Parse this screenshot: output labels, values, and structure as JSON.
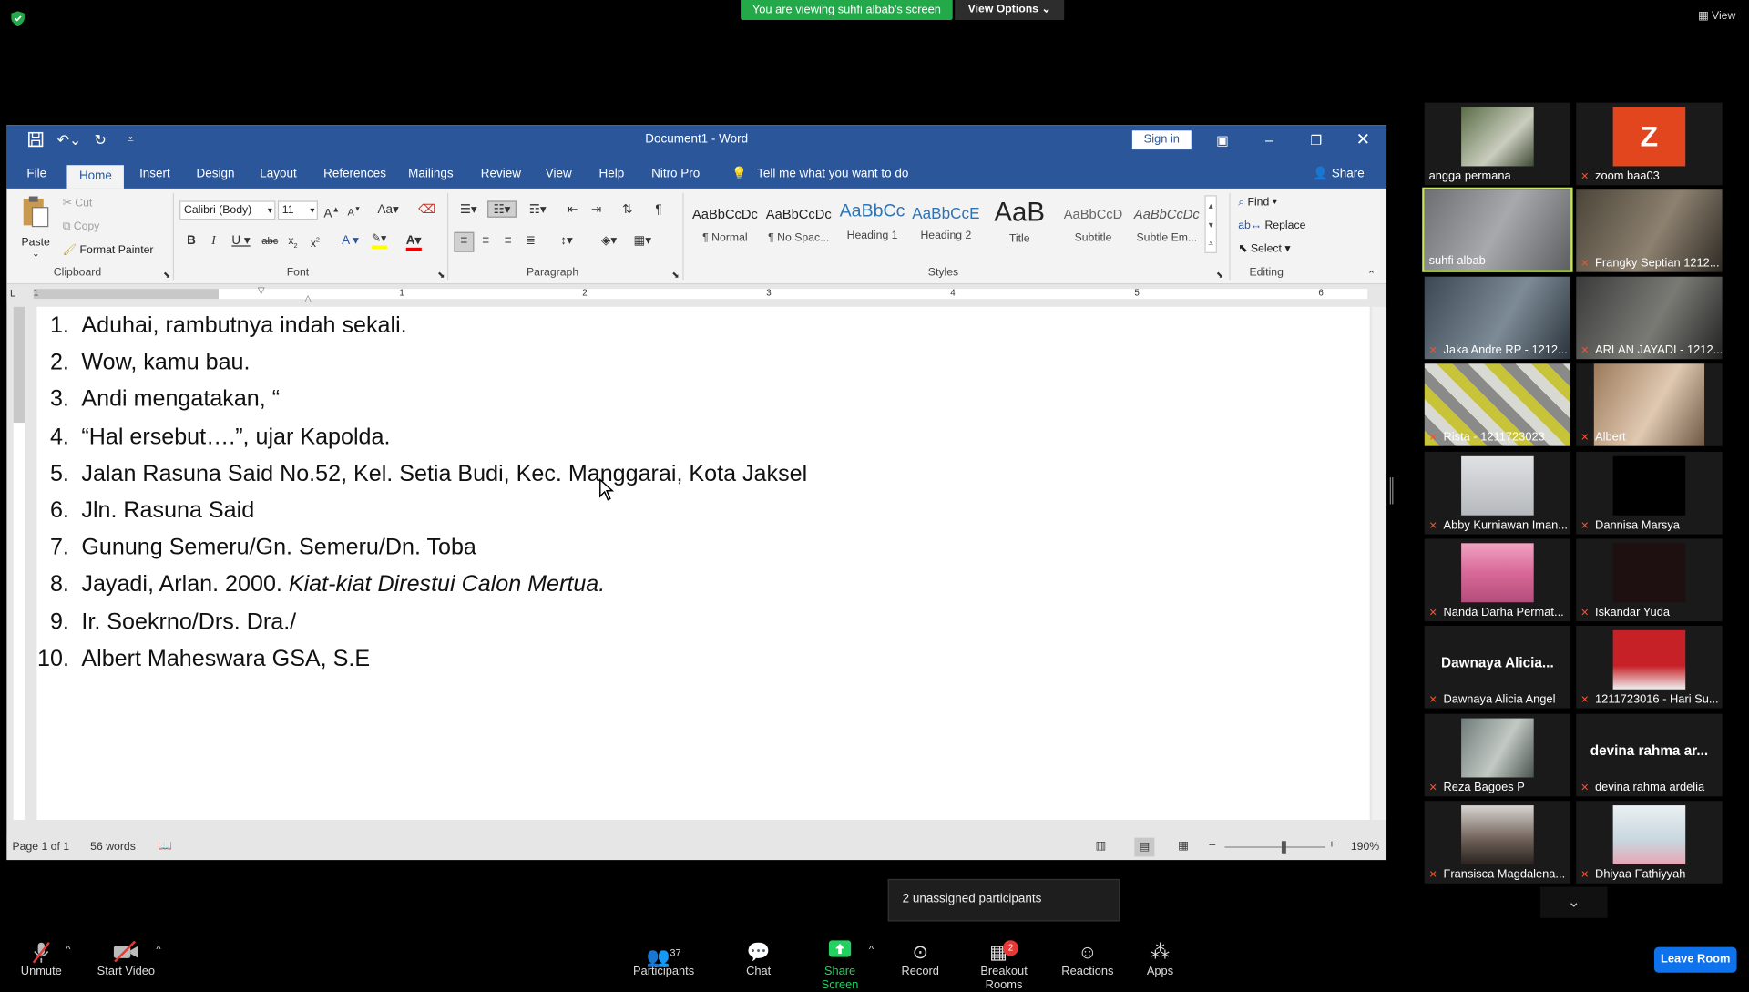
{
  "zoom": {
    "banner": "You are viewing suhfi albab's screen",
    "view_options": "View Options ⌄",
    "view_label": "View",
    "unassigned": "2 unassigned participants",
    "toolbar": {
      "unmute": "Unmute",
      "start_video": "Start Video",
      "participants": "Participants",
      "participants_count": "37",
      "chat": "Chat",
      "share_screen": "Share Screen",
      "record": "Record",
      "breakout_rooms": "Breakout Rooms",
      "breakout_badge": "2",
      "reactions": "Reactions",
      "apps": "Apps",
      "leave": "Leave Room"
    },
    "participants": [
      {
        "name": "angga permana",
        "muted": false,
        "video": true
      },
      {
        "name": "zoom baa03",
        "muted": true,
        "video": false,
        "initial": "Z"
      },
      {
        "name": "suhfi albab",
        "muted": false,
        "video": true,
        "speaking": true
      },
      {
        "name": "Frangky Septian 1212...",
        "muted": true,
        "video": true
      },
      {
        "name": "Jaka Andre RP - 1212...",
        "muted": true,
        "video": true
      },
      {
        "name": "ARLAN JAYADI - 1212...",
        "muted": true,
        "video": true
      },
      {
        "name": "Rista - 1211723023",
        "muted": true,
        "video": true
      },
      {
        "name": "Albert",
        "muted": true,
        "video": true
      },
      {
        "name": "Abby Kurniawan Iman...",
        "muted": true,
        "video": true
      },
      {
        "name": "Dannisa Marsya",
        "muted": true,
        "video": true
      },
      {
        "name": "Nanda Darha Permat...",
        "muted": true,
        "video": true
      },
      {
        "name": "Iskandar Yuda",
        "muted": true,
        "video": true
      },
      {
        "name": "Dawnaya Alicia Angel",
        "muted": true,
        "video": false,
        "big_label": "Dawnaya  Alicia..."
      },
      {
        "name": "1211723016 - Hari Su...",
        "muted": true,
        "video": true
      },
      {
        "name": "Reza Bagoes P",
        "muted": true,
        "video": true
      },
      {
        "name": "devina rahma ardelia",
        "muted": true,
        "video": false,
        "big_label": "devina rahma ar..."
      },
      {
        "name": "Fransisca Magdalena...",
        "muted": true,
        "video": true
      },
      {
        "name": "Dhiyaa Fathiyyah",
        "muted": true,
        "video": true
      }
    ]
  },
  "word": {
    "title": "Document1  -  Word",
    "sign_in": "Sign in",
    "share": "Share",
    "tabs": [
      "File",
      "Home",
      "Insert",
      "Design",
      "Layout",
      "References",
      "Mailings",
      "Review",
      "View",
      "Help",
      "Nitro Pro"
    ],
    "tell_me": "Tell me what you want to do",
    "clipboard": {
      "paste": "Paste",
      "cut": "Cut",
      "copy": "Copy",
      "format_painter": "Format Painter",
      "label": "Clipboard"
    },
    "font": {
      "name": "Calibri (Body)",
      "size": "11",
      "label": "Font"
    },
    "paragraph_label": "Paragraph",
    "styles": {
      "label": "Styles",
      "items": [
        {
          "preview": "AaBbCcDc",
          "name": "¶ Normal"
        },
        {
          "preview": "AaBbCcDc",
          "name": "¶ No Spac..."
        },
        {
          "preview": "AaBbCc",
          "name": "Heading 1"
        },
        {
          "preview": "AaBbCcE",
          "name": "Heading 2"
        },
        {
          "preview": "AaB",
          "name": "Title"
        },
        {
          "preview": "AaBbCcD",
          "name": "Subtitle"
        },
        {
          "preview": "AaBbCcDc",
          "name": "Subtle Em..."
        }
      ]
    },
    "editing": {
      "find": "Find",
      "replace": "Replace",
      "select": "Select",
      "label": "Editing"
    },
    "ruler_numbers": [
      "1",
      "1",
      "2",
      "3",
      "4",
      "5",
      "6"
    ],
    "document_lines": [
      {
        "n": "1.",
        "text": "Aduhai, rambutnya indah sekali."
      },
      {
        "n": "2.",
        "text": "Wow, kamu bau."
      },
      {
        "n": "3.",
        "text": "Andi mengatakan, “"
      },
      {
        "n": "4.",
        "text": "“Hal ersebut….”, ujar Kapolda."
      },
      {
        "n": "5.",
        "text": "Jalan Rasuna Said No.52, Kel. Setia Budi, Kec. Manggarai, Kota Jaksel"
      },
      {
        "n": "6.",
        "text": "Jln. Rasuna Said"
      },
      {
        "n": "7.",
        "text": "Gunung Semeru/Gn. Semeru/Dn. Toba"
      },
      {
        "n": "8.",
        "text": "Jayadi, Arlan. 2000. Kiat-kiat Direstui Calon Mertua."
      },
      {
        "n": "9.",
        "text": "Ir. Soekrno/Drs. Dra./"
      },
      {
        "n": "10.",
        "text": "Albert Maheswara GSA, S.E"
      }
    ],
    "status": {
      "page": "Page 1 of 1",
      "words": "56 words",
      "zoom": "190%"
    }
  },
  "colors": {
    "word_blue": "#2b579a",
    "zoom_green": "#23a94a",
    "leave_blue": "#0e72ed"
  }
}
